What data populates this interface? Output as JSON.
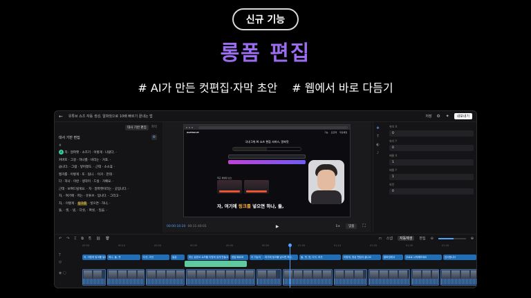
{
  "promo": {
    "badge": "신규 기능",
    "title": "롱폼 편집",
    "subtitle_left": "# AI가 만든 컷편집·자막 초안",
    "subtitle_right": "# 웹에서 바로 다듬기"
  },
  "app": {
    "topbar": {
      "title": "유튜브 쇼츠 자동 생성, 알파컷으로 10배 빠르기 끝내는 법",
      "save_label": "저장",
      "export_label": "내보내기"
    },
    "left_panel": {
      "tab_script": "대사 기반 편집",
      "tab_other": "자막",
      "heading": "대사 기반 편집",
      "hash": "#",
      "speaker": "A",
      "script_rows": [
        [
          "자",
          "알파캣",
          "소즈기",
          "이렇게",
          "나왔다."
        ],
        [
          "커버포",
          "그걸",
          "하나를",
          "비리는",
          "거죠."
        ],
        [
          "습니다.",
          "그럼",
          "넣어졌도.",
          "근데",
          "소소휴"
        ],
        [
          "쩡거를",
          "이렇게",
          "또",
          "됩니.",
          "이거",
          "한데"
        ],
        [
          "다",
          "하나",
          "이런",
          "생각이",
          "드실",
          "거예요."
        ],
        [
          "근데",
          "보여드릴게요.",
          "자",
          "알파캣이라는",
          "곳입니다."
        ],
        [
          "자,",
          "여기에",
          "저는",
          "유튜브",
          "입니다.",
          "그리고"
        ],
        [
          "자,",
          "이렇게",
          "링크를",
          "넣으면",
          "하나,"
        ],
        [
          "둘,",
          "셋,",
          "넷,",
          "다섯,",
          "여섯,",
          "일곱."
        ]
      ],
      "highlight_word": "링크를"
    },
    "preview": {
      "site_logo": "ALPHACUT",
      "site_nav": [
        "기능",
        "요금제",
        "무료체험"
      ],
      "site_hero": "국내 1위 AI 쇼츠 편집 서비스, 알파컷",
      "section_title": "최근 생성된 쇼츠",
      "subtitle_prefix": "자, 여기에 ",
      "subtitle_link": "링크를",
      "subtitle_suffix": " 넣으면 하나, 둘,",
      "timecode": "00:00:10:20",
      "total_time": "00:11:40:01",
      "speed": "1×",
      "fit_label": "맞춤"
    },
    "props": [
      {
        "label": "위치 X",
        "value": "0"
      },
      {
        "label": "위치 Y",
        "value": "0"
      },
      {
        "label": "배율 X",
        "value": "1"
      },
      {
        "label": "배율 Y",
        "value": "1"
      },
      {
        "label": "회전",
        "value": "0"
      }
    ],
    "timeline": {
      "snap_label": "스냅",
      "mode_active": "자동재생",
      "mode_other": "편집",
      "ruler": [
        "00:00",
        "00:10",
        "00:20",
        "00:30",
        "00:40",
        "00:50",
        "01:00",
        "01:10",
        "01:20",
        "01:30",
        "01:40",
        "01:50"
      ],
      "captions": [
        "자, 이렇게 링크를 넣으면",
        "하나, 둘, 셋",
        "다섯, 여섯",
        "일곱.",
        "저는 유튜브 쇼츠를 이렇게 쉽게 만들고 있어요",
        "정말 빠르죠",
        "이 기능이",
        "여기에 링크를 넣으면 하나,",
        "둘, 셋, 넷, 다섯, 여섯",
        "이렇게, 영상 편집이 끝나요",
        "알파컷에서",
        "무료로 시작해보세요",
        "감사합니다"
      ]
    }
  }
}
